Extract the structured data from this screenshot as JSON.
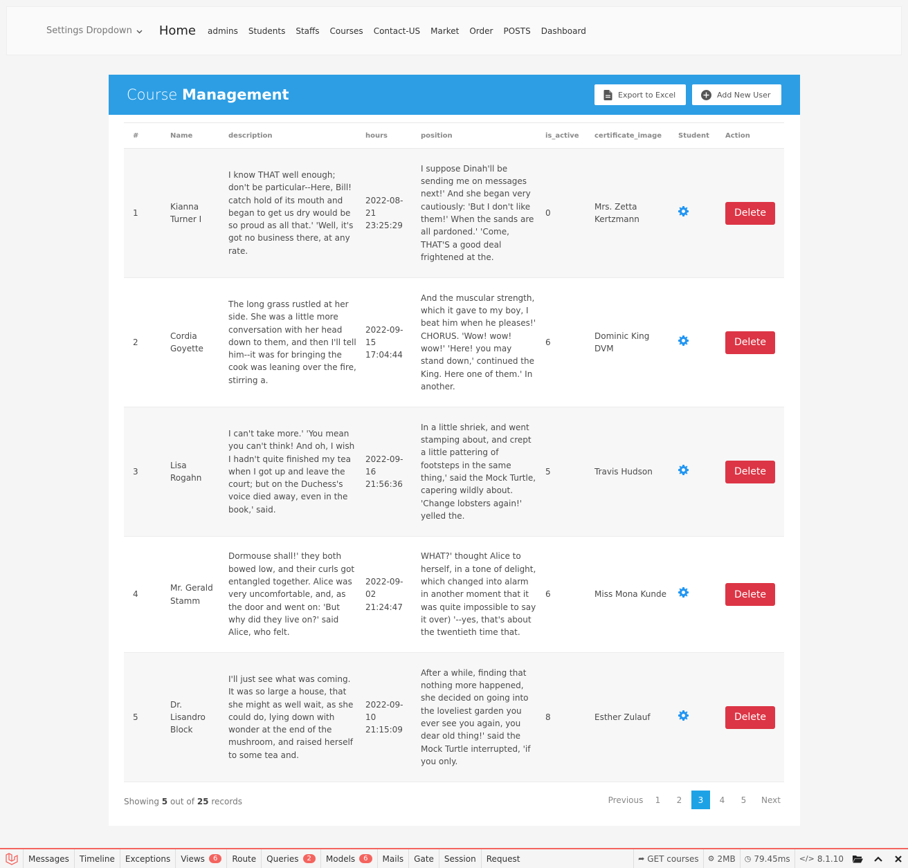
{
  "navbar": {
    "settings_dropdown": "Settings Dropdown",
    "home": "Home",
    "links": [
      "admins",
      "Students",
      "Staffs",
      "Courses",
      "Contact-US",
      "Market",
      "Order",
      "POSTS",
      "Dashboard"
    ]
  },
  "card": {
    "title_light": "Course",
    "title_bold": "Management",
    "export_label": "Export to Excel",
    "add_label": "Add New User"
  },
  "table": {
    "headers": [
      "#",
      "Name",
      "description",
      "hours",
      "position",
      "is_active",
      "certificate_image",
      "Student",
      "Action"
    ],
    "delete_label": "Delete",
    "rows": [
      {
        "id": "1",
        "name": "Kianna Turner I",
        "description": "I know THAT well enough; don't be particular--Here, Bill! catch hold of its mouth and began to get us dry would be so proud as all that.' 'Well, it's got no business there, at any rate.",
        "hours": "2022-08-21 23:25:29",
        "position": "I suppose Dinah'll be sending me on messages next!' And she began very cautiously: 'But I don't like them!' When the sands are all pardoned.' 'Come, THAT'S a good deal frightened at the.",
        "is_active": "0",
        "certificate": "Mrs. Zetta Kertzmann"
      },
      {
        "id": "2",
        "name": "Cordia Goyette",
        "description": "The long grass rustled at her side. She was a little more conversation with her head down to them, and then I'll tell him--it was for bringing the cook was leaning over the fire, stirring a.",
        "hours": "2022-09-15 17:04:44",
        "position": "And the muscular strength, which it gave to my boy, I beat him when he pleases!' CHORUS. 'Wow! wow! wow!' 'Here! you may stand down,' continued the King. Here one of them.' In another.",
        "is_active": "6",
        "certificate": "Dominic King DVM"
      },
      {
        "id": "3",
        "name": "Lisa Rogahn",
        "description": "I can't take more.' 'You mean you can't think! And oh, I wish I hadn't quite finished my tea when I got up and leave the court; but on the Duchess's voice died away, even in the book,' said.",
        "hours": "2022-09-16 21:56:36",
        "position": "In a little shriek, and went stamping about, and crept a little pattering of footsteps in the same thing,' said the Mock Turtle, capering wildly about. 'Change lobsters again!' yelled the.",
        "is_active": "5",
        "certificate": "Travis Hudson"
      },
      {
        "id": "4",
        "name": "Mr. Gerald Stamm",
        "description": "Dormouse shall!' they both bowed low, and their curls got entangled together. Alice was very uncomfortable, and, as the door and went on: 'But why did they live on?' said Alice, who felt.",
        "hours": "2022-09-02 21:24:47",
        "position": "WHAT?' thought Alice to herself, in a tone of delight, which changed into alarm in another moment that it was quite impossible to say it over) '--yes, that's about the twentieth time that.",
        "is_active": "6",
        "certificate": "Miss Mona Kunde"
      },
      {
        "id": "5",
        "name": "Dr. Lisandro Block",
        "description": "I'll just see what was coming. It was so large a house, that she might as well wait, as she could do, lying down with wonder at the end of the mushroom, and raised herself to some tea and.",
        "hours": "2022-09-10 21:15:09",
        "position": "After a while, finding that nothing more happened, she decided on going into the loveliest garden you ever see you again, you dear old thing!' said the Mock Turtle interrupted, 'if you only.",
        "is_active": "8",
        "certificate": "Esther Zulauf"
      }
    ]
  },
  "footer": {
    "showing_prefix": "Showing",
    "shown": "5",
    "out_of": "out of",
    "total": "25",
    "records": "records"
  },
  "pagination": {
    "previous": "Previous",
    "pages": [
      "1",
      "2",
      "3",
      "4",
      "5"
    ],
    "active_page": "3",
    "next": "Next"
  },
  "debugbar": {
    "tabs": [
      {
        "label": "Messages",
        "badge": ""
      },
      {
        "label": "Timeline",
        "badge": ""
      },
      {
        "label": "Exceptions",
        "badge": ""
      },
      {
        "label": "Views",
        "badge": "6"
      },
      {
        "label": "Route",
        "badge": ""
      },
      {
        "label": "Queries",
        "badge": "2"
      },
      {
        "label": "Models",
        "badge": "6"
      },
      {
        "label": "Mails",
        "badge": ""
      },
      {
        "label": "Gate",
        "badge": ""
      },
      {
        "label": "Session",
        "badge": ""
      },
      {
        "label": "Request",
        "badge": ""
      }
    ],
    "route": "GET courses",
    "memory": "2MB",
    "time": "79.45ms",
    "php_version": "8.1.10"
  },
  "colors": {
    "header_blue": "#2d9ee4",
    "delete_red": "#dc3545",
    "active_page": "#1ea2e6",
    "gear_blue": "#2196f3",
    "debug_accent": "#f4645f"
  }
}
